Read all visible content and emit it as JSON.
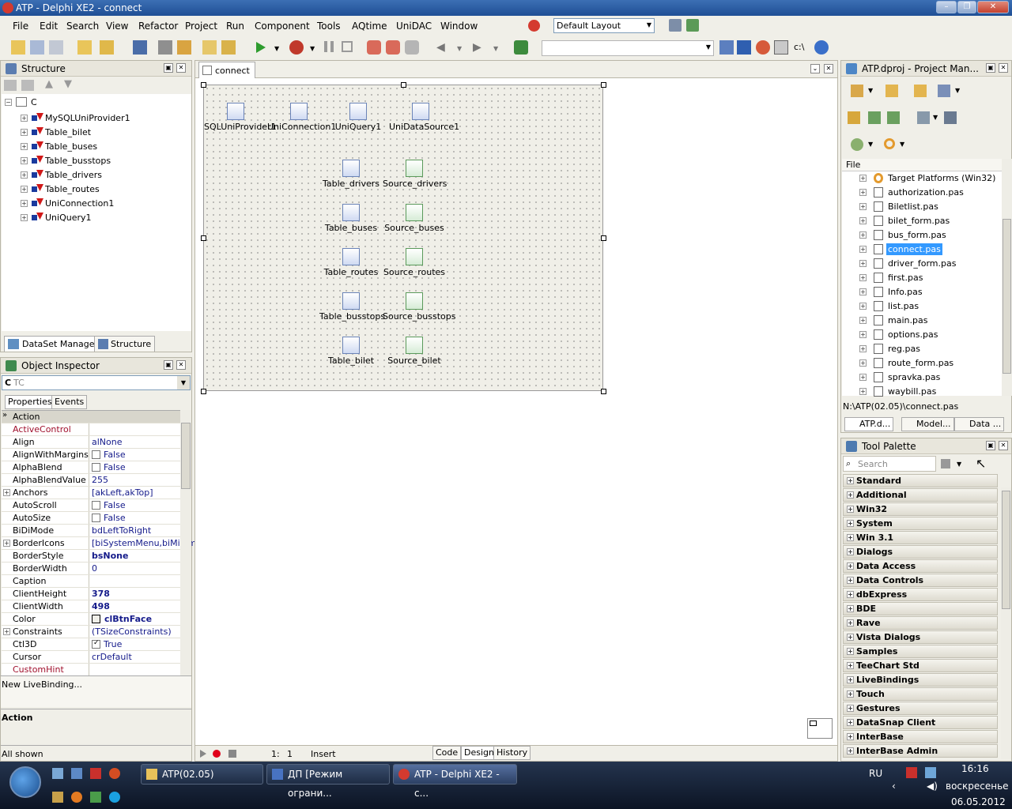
{
  "window": {
    "title": "ATP - Delphi XE2 - connect"
  },
  "menu": [
    "File",
    "Edit",
    "Search",
    "View",
    "Refactor",
    "Project",
    "Run",
    "Component",
    "Tools",
    "AQtime",
    "UniDAC",
    "Window"
  ],
  "layout_select": "Default Layout",
  "structure": {
    "title": "Structure",
    "root": "C",
    "items": [
      "MySQLUniProvider1",
      "Table_bilet",
      "Table_buses",
      "Table_busstops",
      "Table_drivers",
      "Table_routes",
      "UniConnection1",
      "UniQuery1"
    ],
    "tabs": [
      "DataSet Manager",
      "Structure"
    ]
  },
  "object_inspector": {
    "title": "Object Inspector",
    "selected_name": "C",
    "selected_type": "TC",
    "tabs": [
      "Properties",
      "Events"
    ],
    "rows": [
      {
        "name": "Action",
        "value": ""
      },
      {
        "name": "ActiveControl",
        "value": ""
      },
      {
        "name": "Align",
        "value": "alNone"
      },
      {
        "name": "AlignWithMargins",
        "value": "False"
      },
      {
        "name": "AlphaBlend",
        "value": "False"
      },
      {
        "name": "AlphaBlendValue",
        "value": "255"
      },
      {
        "name": "Anchors",
        "value": "[akLeft,akTop]"
      },
      {
        "name": "AutoScroll",
        "value": "False"
      },
      {
        "name": "AutoSize",
        "value": "False"
      },
      {
        "name": "BiDiMode",
        "value": "bdLeftToRight"
      },
      {
        "name": "BorderIcons",
        "value": "[biSystemMenu,biMinim"
      },
      {
        "name": "BorderStyle",
        "value": "bsNone"
      },
      {
        "name": "BorderWidth",
        "value": "0"
      },
      {
        "name": "Caption",
        "value": ""
      },
      {
        "name": "ClientHeight",
        "value": "378"
      },
      {
        "name": "ClientWidth",
        "value": "498"
      },
      {
        "name": "Color",
        "value": "clBtnFace"
      },
      {
        "name": "Constraints",
        "value": "(TSizeConstraints)"
      },
      {
        "name": "Ctl3D",
        "value": "True"
      },
      {
        "name": "Cursor",
        "value": "crDefault"
      },
      {
        "name": "CustomHint",
        "value": ""
      }
    ],
    "link": "New LiveBinding...",
    "desc_title": "Action",
    "footer": "All shown"
  },
  "editor": {
    "tab": "connect",
    "components_top": [
      "SQLUniProvider1",
      "UniConnection1",
      "UniQuery1",
      "UniDataSource1"
    ],
    "pairs": [
      {
        "table": "Table_drivers",
        "source": "Source_drivers"
      },
      {
        "table": "Table_buses",
        "source": "Source_buses"
      },
      {
        "table": "Table_routes",
        "source": "Source_routes"
      },
      {
        "table": "Table_busstops",
        "source": "Source_busstops"
      },
      {
        "table": "Table_bilet",
        "source": "Source_bilet"
      }
    ],
    "status": {
      "line": "1:",
      "col": "1",
      "mode": "Insert"
    },
    "bottom_tabs": [
      "Code",
      "Design",
      "History"
    ]
  },
  "project_manager": {
    "title": "ATP.dproj - Project Man...",
    "column": "File",
    "items": [
      "Target Platforms (Win32)",
      "authorization.pas",
      "Biletlist.pas",
      "bilet_form.pas",
      "bus_form.pas",
      "connect.pas",
      "driver_form.pas",
      "first.pas",
      "Info.pas",
      "list.pas",
      "main.pas",
      "options.pas",
      "reg.pas",
      "route_form.pas",
      "spravka.pas",
      "waybill.pas"
    ],
    "selected": "connect.pas",
    "path": "N:\\ATP(02.05)\\connect.pas",
    "tabs": [
      "ATP.d...",
      "Model...",
      "Data ..."
    ]
  },
  "tool_palette": {
    "title": "Tool Palette",
    "search_placeholder": "Search",
    "categories": [
      "Standard",
      "Additional",
      "Win32",
      "System",
      "Win 3.1",
      "Dialogs",
      "Data Access",
      "Data Controls",
      "dbExpress",
      "BDE",
      "Rave",
      "Vista Dialogs",
      "Samples",
      "TeeChart Std",
      "LiveBindings",
      "Touch",
      "Gestures",
      "DataSnap Client",
      "InterBase",
      "InterBase Admin"
    ]
  },
  "taskbar": {
    "buttons": [
      "ATP(02.05)",
      "ДП [Режим ограни...",
      "ATP - Delphi XE2 - c..."
    ],
    "lang": "RU",
    "time": "16:16",
    "day": "воскресенье",
    "date": "06.05.2012"
  },
  "colors": {
    "title": "#1f4f95",
    "selection": "#3399ff",
    "prop_red": "#a0102c",
    "value_blue": "#141a8a"
  }
}
